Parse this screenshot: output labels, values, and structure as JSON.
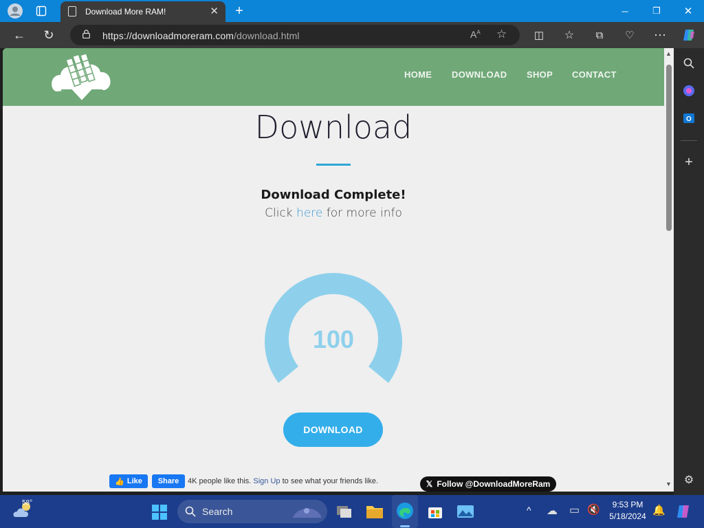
{
  "browser": {
    "tab_title": "Download More RAM!",
    "url_host": "https://downloadmoreram.com",
    "url_path": "/download.html"
  },
  "site": {
    "nav": [
      "HOME",
      "DOWNLOAD",
      "SHOP",
      "CONTACT"
    ],
    "title": "Download",
    "status": "Download Complete!",
    "info_prefix": "Click ",
    "info_link": "here",
    "info_suffix": " for more info",
    "gauge_value": "100",
    "download_button": "DOWNLOAD",
    "fb_like": "Like",
    "fb_share": "Share",
    "fb_text": "4K people like this.",
    "fb_signup": "Sign Up",
    "fb_text_suffix": "to see what your friends like.",
    "x_follow": "Follow @DownloadMoreRam"
  },
  "taskbar": {
    "weather": "58°",
    "search_label": "Search",
    "time": "9:53 PM",
    "date": "5/18/2024"
  },
  "colors": {
    "header_green": "#70a878",
    "accent_blue": "#33aeea",
    "gauge_blue": "#8ed0ec"
  }
}
